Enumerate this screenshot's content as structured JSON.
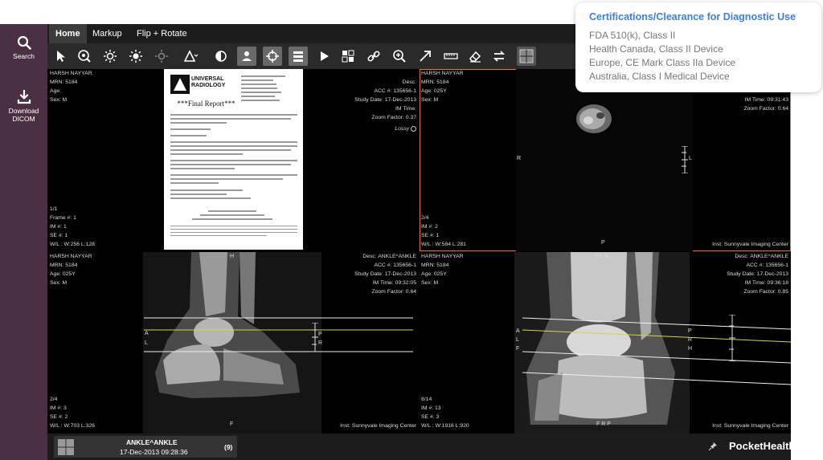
{
  "sidebar": {
    "search_label": "Search",
    "download_label_line1": "Download",
    "download_label_line2": "DICOM"
  },
  "tabs": [
    "Home",
    "Markup",
    "Flip + Rotate"
  ],
  "toolbar_icons": [
    "pointer-icon",
    "zoom-pan-icon",
    "brightness-icon",
    "brightness-plus-icon",
    "brightness-minus-icon",
    "shape-icon",
    "contrast-icon",
    "user-pin-icon",
    "crosshair-icon",
    "slice-stack-icon",
    "play-icon",
    "layout-icon",
    "link-icon",
    "magnify-icon",
    "arrow-icon",
    "ruler-icon",
    "eraser-icon",
    "swap-icon",
    "grid-layout-icon"
  ],
  "viewports": {
    "top_left": {
      "name": "HARSH NAYYAR",
      "mrn": "MRN: 5184",
      "age": "Age:",
      "sex": "Sex: M",
      "frame_idx": "1/1",
      "frame": "Frame #: 1",
      "im": "IM #: 1",
      "se": "SE #: 1",
      "wl": "W/L : W:256 L:128",
      "desc": "Desc:",
      "acc": "ACC #: 135656-1",
      "study_date": "Study Date: 17-Dec-2013",
      "im_time": "IM Time:",
      "zoom": "Zoom Factor: 0.37",
      "lossy": "Lossy"
    },
    "top_right": {
      "name": "HARSH NAYYAR",
      "mrn": "MRN: 5184",
      "age": "Age: 025Y",
      "sex": "Sex: M",
      "frame_idx": "2/4",
      "im": "IM #: 2",
      "se": "SE #: 1",
      "wl": "W/L : W:584 L:281",
      "im_time": "IM Time: 09:31:43",
      "zoom": "Zoom Factor: 0.64",
      "inst": "Inst: Sunnyvale Imaging Center",
      "orient_r": "R",
      "orient_l": "L",
      "orient_p": "P"
    },
    "bottom_left": {
      "name": "HARSH NAYYAR",
      "mrn": "MRN: 5184",
      "age": "Age: 025Y",
      "sex": "Sex: M",
      "frame_idx": "2/4",
      "im": "IM #: 3",
      "se": "SE #: 2",
      "wl": "W/L : W:703 L:326",
      "desc": "Desc: ANKLE^ANKLE",
      "acc": "ACC #: 135656-1",
      "study_date": "Study Date: 17-Dec-2013",
      "im_time": "IM Time: 09:32:05",
      "zoom": "Zoom Factor: 0.64",
      "inst": "Inst: Sunnyvale Imaging Center",
      "orient_h": "H",
      "orient_a": "A",
      "orient_l": "L",
      "orient_p": "P",
      "orient_r": "R",
      "orient_f": "F"
    },
    "bottom_right": {
      "name": "HARSH NAYYAR",
      "mrn": "MRN: 5184",
      "age": "Age: 025Y",
      "sex": "Sex: M",
      "frame_idx": "8/14",
      "im": "IM #: 13",
      "se": "SE #: 3",
      "wl": "W/L : W:1916 L:920",
      "desc": "Desc: ANKLE^ANKLE",
      "acc": "ACC #: 135656-1",
      "study_date": "Study Date: 17-Dec-2013",
      "im_time": "IM Time: 09:36:18",
      "zoom": "Zoom Factor: 0.85",
      "inst": "Inst: Sunnyvale Imaging Center",
      "orient_top": "H L A",
      "orient_a": "A",
      "orient_l": "L",
      "orient_f": "F",
      "orient_p": "P",
      "orient_r": "R",
      "orient_h": "H",
      "orient_bottom": "F R P"
    }
  },
  "report": {
    "logo_line1": "UNIVERSAL",
    "logo_line2": "RADIOLOGY",
    "title": "***Final Report***"
  },
  "bottom_bar": {
    "series_title": "ANKLE^ANKLE",
    "series_date": "17-Dec-2013 09:28:36",
    "series_count": "(9)",
    "brand": "PocketHealth"
  },
  "certifications": {
    "title": "Certifications/Clearance for Diagnostic Use",
    "items": [
      "FDA 510(k), Class II",
      "Health Canada, Class II Device",
      "Europe, CE Mark Class IIa Device",
      "Australia, Class I Medical Device"
    ]
  }
}
